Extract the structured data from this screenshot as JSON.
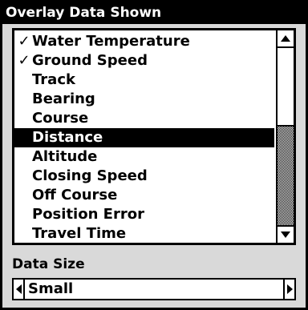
{
  "window": {
    "title": "Overlay Data Shown"
  },
  "list": {
    "items": [
      {
        "label": "Water Temperature",
        "check": "✓"
      },
      {
        "label": "Ground Speed",
        "check": "✓"
      },
      {
        "label": "Track",
        "check": ""
      },
      {
        "label": "Bearing",
        "check": ""
      },
      {
        "label": "Course",
        "check": ""
      },
      {
        "label": "Distance",
        "check": ""
      },
      {
        "label": "Altitude",
        "check": ""
      },
      {
        "label": "Closing Speed",
        "check": ""
      },
      {
        "label": "Off Course",
        "check": ""
      },
      {
        "label": "Position Error",
        "check": ""
      },
      {
        "label": "Travel Time",
        "check": ""
      }
    ],
    "selected_item": "Distance"
  },
  "data_size": {
    "label": "Data Size",
    "value": "Small"
  },
  "colors": {
    "background": "#d9d9d9",
    "selection": "#000000",
    "list_background": "#ffffff"
  },
  "icons": {
    "check": "check-icon",
    "scroll_up": "up-arrow-icon",
    "scroll_down": "down-arrow-icon",
    "prev": "left-arrow-icon",
    "next": "right-arrow-icon"
  }
}
